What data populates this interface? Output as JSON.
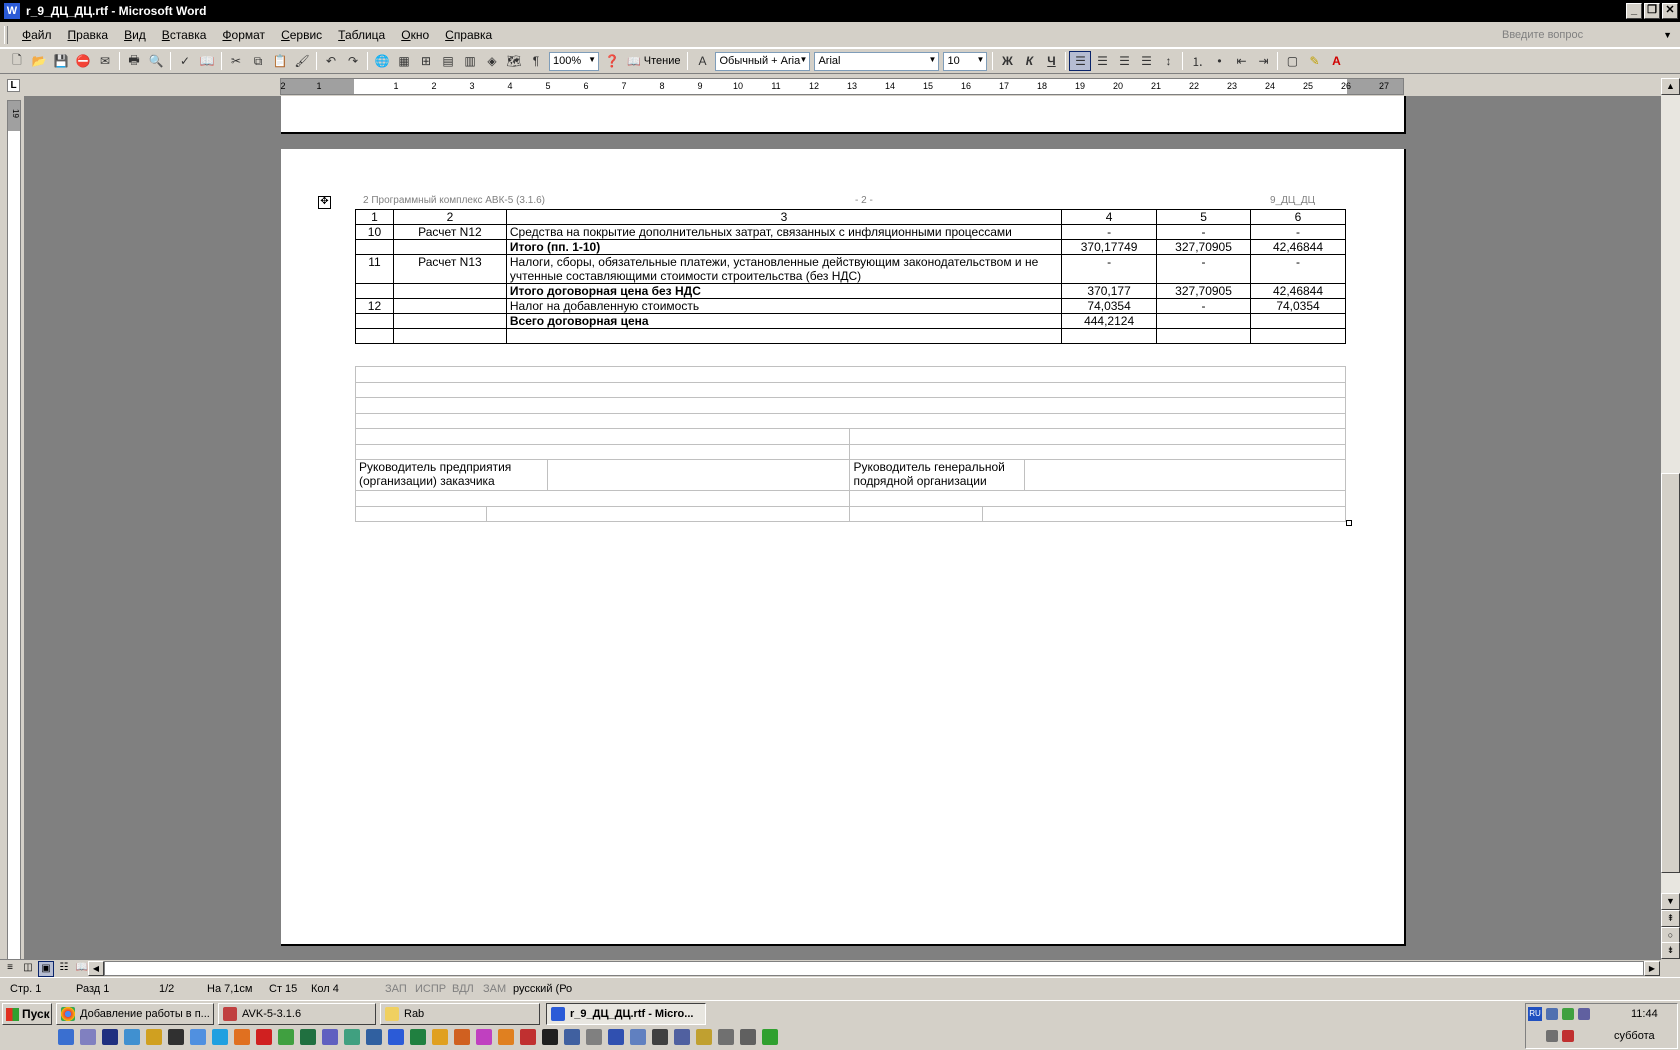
{
  "window": {
    "title": "r_9_ДЦ_ДЦ.rtf - Microsoft Word"
  },
  "menu": [
    "Файл",
    "Правка",
    "Вид",
    "Вставка",
    "Формат",
    "Сервис",
    "Таблица",
    "Окно",
    "Справка"
  ],
  "help_placeholder": "Введите вопрос",
  "toolbar": {
    "zoom": "100%",
    "reading_label": "Чтение",
    "style": "Обычный + Aria",
    "font": "Arial",
    "size": "10"
  },
  "ruler": {
    "numbers": [
      "2",
      "1",
      "1",
      "2",
      "3",
      "4",
      "5",
      "6",
      "7",
      "8",
      "9",
      "10",
      "11",
      "12",
      "13",
      "14",
      "15",
      "16",
      "17",
      "18",
      "19",
      "20",
      "21",
      "22",
      "23",
      "24",
      "25",
      "26",
      "27"
    ],
    "vertical_number": "19"
  },
  "page_header": {
    "left": "2 Программный комплекс АВК-5 (3.1.6)",
    "center": "- 2 -",
    "right": "9_ДЦ_ДЦ"
  },
  "table": {
    "headers": [
      "1",
      "2",
      "3",
      "4",
      "5",
      "6"
    ],
    "rows": [
      {
        "n": "10",
        "calc": "Расчет N12",
        "desc": "Средства на покрытие дополнительных затрат, связанных с инфляционными процессами",
        "c4": "-",
        "c5": "-",
        "c6": "-",
        "bold": false
      },
      {
        "n": "",
        "calc": "",
        "desc": "Итого (пп. 1-10)",
        "c4": "370,17749",
        "c5": "327,70905",
        "c6": "42,46844",
        "bold": true
      },
      {
        "n": "11",
        "calc": "Расчет N13",
        "desc": "Налоги, сборы, обязательные платежи, установленные действующим законодательством и не учтенные составляющими стоимости строительства (без НДС)",
        "c4": "-",
        "c5": "-",
        "c6": "-",
        "bold": false
      },
      {
        "n": "",
        "calc": "",
        "desc": "Итого договорная цена без НДС",
        "c4": "370,177",
        "c5": "327,70905",
        "c6": "42,46844",
        "bold": true
      },
      {
        "n": "12",
        "calc": "",
        "desc": "Налог на добавленную стоимость",
        "c4": "74,0354",
        "c5": "-",
        "c6": "74,0354",
        "bold": false
      },
      {
        "n": "",
        "calc": "",
        "desc": "Всего договорная цена",
        "c4": "444,2124",
        "c5": "",
        "c6": "",
        "bold": true
      },
      {
        "n": "",
        "calc": "",
        "desc": "",
        "c4": "",
        "c5": "",
        "c6": "",
        "bold": false
      }
    ]
  },
  "signatures": {
    "left": "Руководитель предприятия (организации) заказчика",
    "right": "Руководитель генеральной подрядной организации"
  },
  "status": {
    "page": "Стр. 1",
    "section": "Разд 1",
    "pages": "1/2",
    "at": "На 7,1см",
    "line": "Ст 15",
    "col": "Кол 4",
    "rec": "ЗАП",
    "trk": "ИСПР",
    "ext": "ВДЛ",
    "ovr": "ЗАМ",
    "lang": "русский (Ро"
  },
  "taskbar": {
    "start": "Пуск",
    "tasks": [
      "Добавление работы в п...",
      "AVK-5-3.1.6",
      "Rab",
      "r_9_ДЦ_ДЦ.rtf - Micro..."
    ],
    "lang": "RU",
    "time": "11:44",
    "day": "суббота"
  }
}
